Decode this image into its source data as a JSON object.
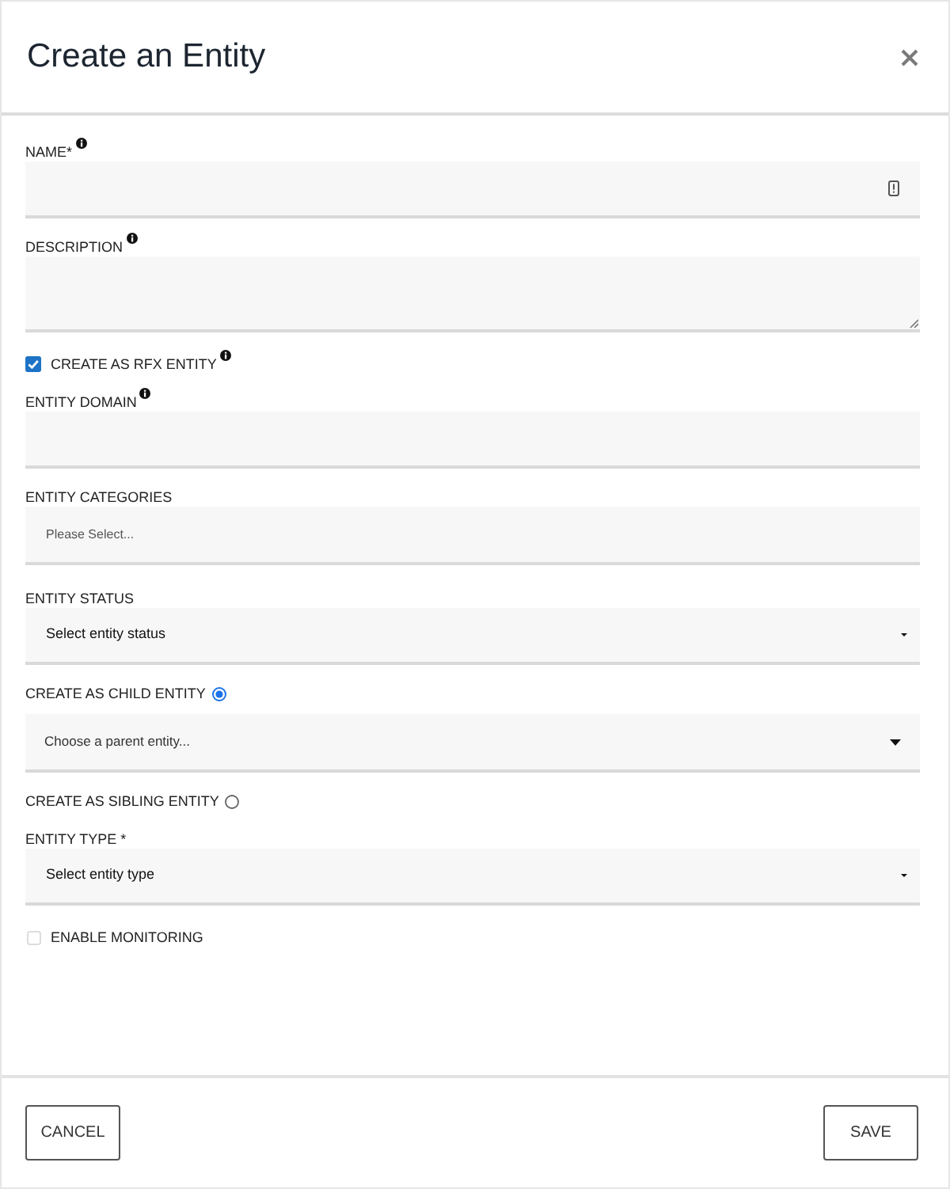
{
  "dialog": {
    "title": "Create an Entity"
  },
  "fields": [
    {
      "kind": "text",
      "label": "NAME*",
      "info": true,
      "trailing_icon": true
    },
    {
      "kind": "textarea",
      "label": "DESCRIPTION",
      "info": true
    },
    {
      "kind": "checkbox",
      "label": "CREATE AS RFX ENTITY",
      "info": true,
      "checked": true,
      "disabled": false
    },
    {
      "kind": "text",
      "label": "ENTITY DOMAIN",
      "info": true
    },
    {
      "kind": "multiselect",
      "label": "ENTITY CATEGORIES",
      "placeholder": "Please Select..."
    },
    {
      "kind": "select",
      "label": "ENTITY STATUS",
      "placeholder": "Select entity status"
    },
    {
      "kind": "radio",
      "label": "CREATE AS CHILD ENTITY",
      "selected": true,
      "field": {
        "kind": "combobox",
        "placeholder": "Choose a parent entity..."
      }
    },
    {
      "kind": "radio",
      "label": "CREATE AS SIBLING ENTITY",
      "selected": false
    },
    {
      "kind": "select",
      "label": "ENTITY TYPE *",
      "placeholder": "Select entity type"
    },
    {
      "kind": "checkbox",
      "label": "ENABLE MONITORING",
      "checked": false,
      "disabled": true
    }
  ],
  "buttons": [
    "CANCEL",
    "SAVE"
  ]
}
